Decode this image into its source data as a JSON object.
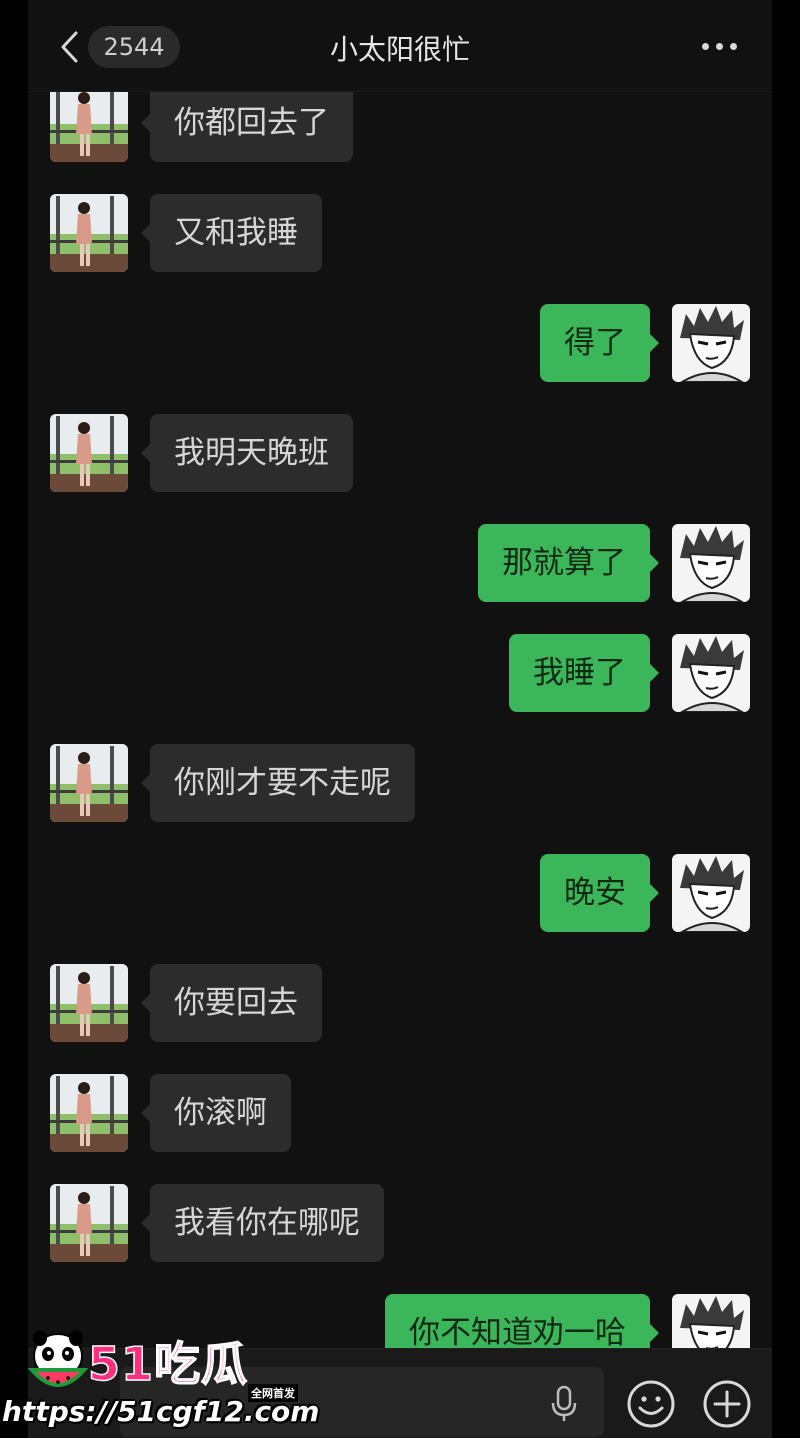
{
  "header": {
    "back_icon": "chevron-left-icon",
    "unread_count": "2544",
    "title": "小太阳很忙",
    "more_icon": "more-dots-icon"
  },
  "messages": [
    {
      "side": "in",
      "text": "你都回去了"
    },
    {
      "side": "in",
      "text": "又和我睡"
    },
    {
      "side": "out",
      "text": "得了"
    },
    {
      "side": "in",
      "text": "我明天晚班"
    },
    {
      "side": "out",
      "text": "那就算了"
    },
    {
      "side": "out",
      "text": "我睡了"
    },
    {
      "side": "in",
      "text": "你刚才要不走呢"
    },
    {
      "side": "out",
      "text": "晚安"
    },
    {
      "side": "in",
      "text": "你要回去"
    },
    {
      "side": "in",
      "text": "你滚啊"
    },
    {
      "side": "in",
      "text": "我看你在哪呢"
    },
    {
      "side": "out",
      "text": "你不知道劝一哈"
    }
  ],
  "input_bar": {
    "mic_icon": "microphone-icon",
    "emoji_icon": "emoji-icon",
    "plus_icon": "plus-circle-icon"
  },
  "watermark": {
    "title": "51吃瓜",
    "tag": "全网首发",
    "url": "https://51cgf12.com"
  },
  "colors": {
    "background": "#111111",
    "incoming_bubble": "#2c2c2c",
    "outgoing_bubble": "#3cb65a",
    "watermark_pink": "#ff2f7d"
  }
}
